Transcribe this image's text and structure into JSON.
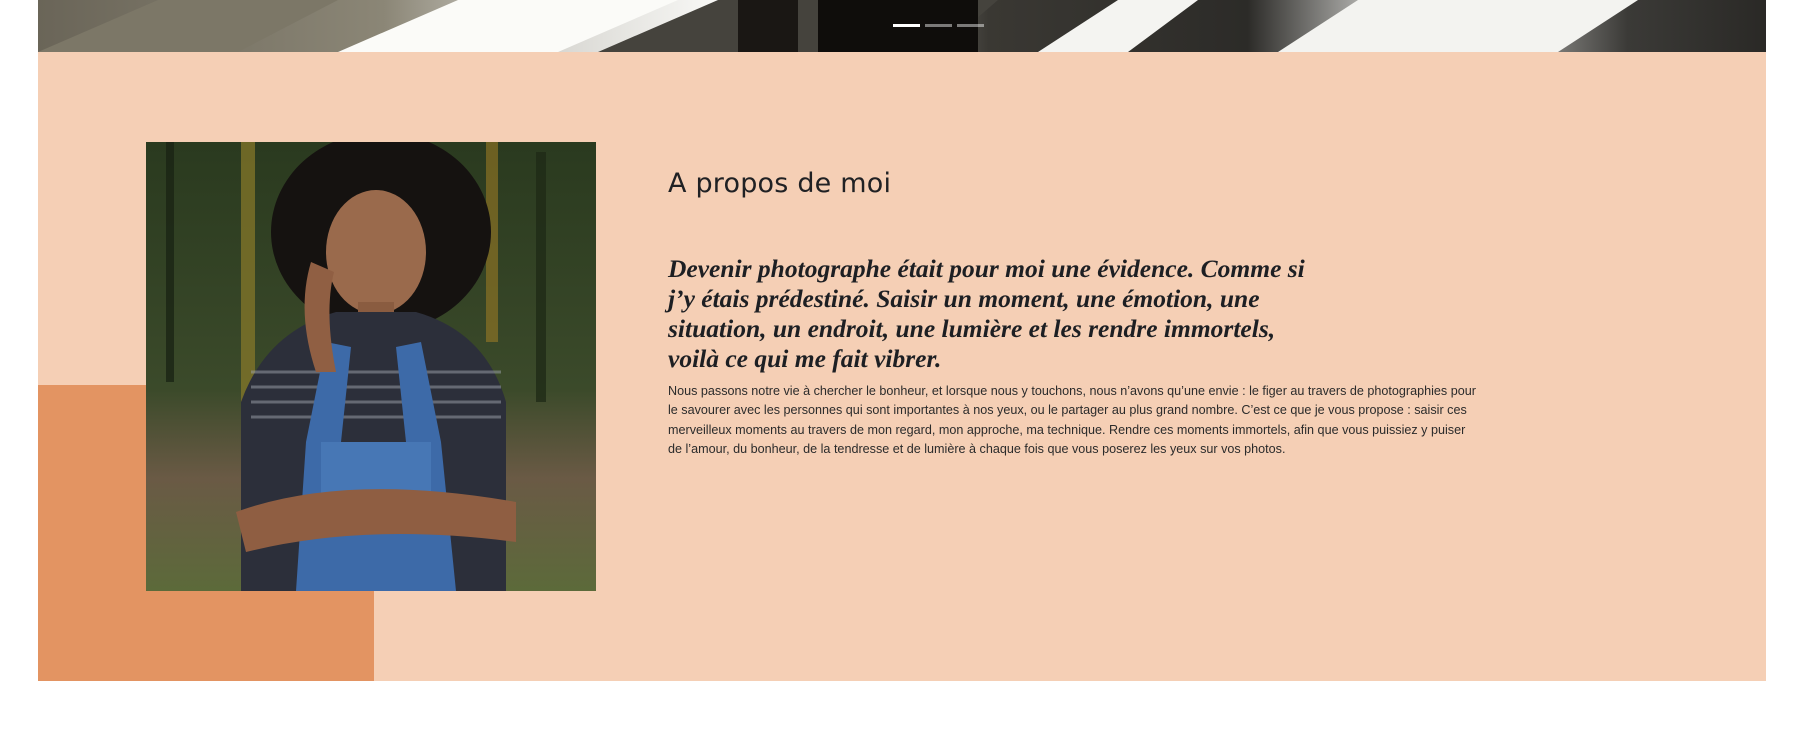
{
  "hero": {
    "slides": [
      {
        "label": "Slide 1",
        "active": true
      },
      {
        "label": "Slide 2",
        "active": false
      },
      {
        "label": "Slide 3",
        "active": false
      }
    ]
  },
  "about": {
    "title": "A propos de moi",
    "quote": "Devenir photographe était pour moi une évidence. Comme si j’y étais prédestiné. Saisir un moment, une émotion, une situation, un endroit, une lumière et les rendre immortels, voilà ce qui me fait vibrer.",
    "body": "Nous passons notre vie à chercher le bonheur, et lorsque nous y touchons, nous n’avons qu’une envie : le figer au travers de photographies pour le savourer avec les personnes qui sont importantes à nos yeux, ou le partager au plus grand nombre. C’est ce que je vous propose : saisir ces merveilleux moments au travers de mon regard, mon approche, ma technique. Rendre ces moments immortels, afin que vous puissiez y puiser de l’amour, du bonheur, de la tendresse et de lumière à chaque fois que vous poserez les yeux sur vos photos."
  },
  "colors": {
    "section_bg": "#f5cfb5",
    "accent_block": "#e39462",
    "text_dark": "#1d1f23"
  }
}
